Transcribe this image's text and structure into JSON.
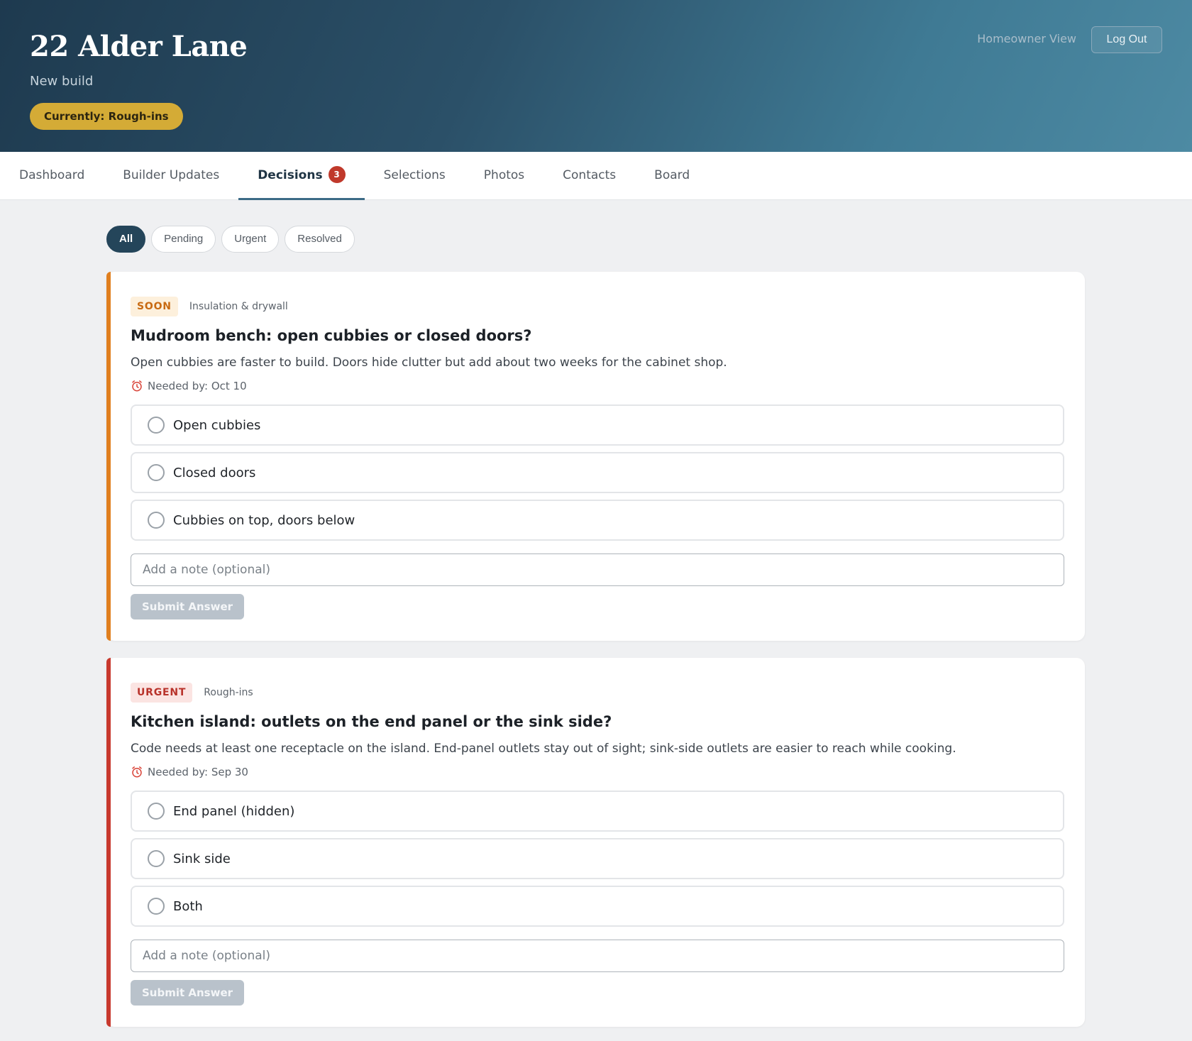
{
  "header": {
    "title": "22 Alder Lane",
    "subtitle": "New build",
    "phase_pill": "Currently: Rough-ins",
    "view_label": "Homeowner View",
    "logout_label": "Log Out"
  },
  "tabs": [
    {
      "label": "Dashboard"
    },
    {
      "label": "Builder Updates"
    },
    {
      "label": "Decisions",
      "badge": "3",
      "active": true
    },
    {
      "label": "Selections"
    },
    {
      "label": "Photos"
    },
    {
      "label": "Contacts"
    },
    {
      "label": "Board"
    }
  ],
  "filters": [
    {
      "label": "All",
      "active": true
    },
    {
      "label": "Pending"
    },
    {
      "label": "Urgent"
    },
    {
      "label": "Resolved"
    }
  ],
  "decisions": [
    {
      "tag": "SOON",
      "phase": "Insulation & drywall",
      "title": "Mudroom bench: open cubbies or closed doors?",
      "description": "Open cubbies are faster to build. Doors hide clutter but add about two weeks for the cabinet shop.",
      "needed_by": "Needed by: Oct 10",
      "options": [
        "Open cubbies",
        "Closed doors",
        "Cubbies on top, doors below"
      ],
      "note_placeholder": "Add a note (optional)",
      "submit_label": "Submit Answer"
    },
    {
      "tag": "URGENT",
      "phase": "Rough-ins",
      "title": "Kitchen island: outlets on the end panel or the sink side?",
      "description": "Code needs at least one receptacle on the island. End-panel outlets stay out of sight; sink-side outlets are easier to reach while cooking.",
      "needed_by": "Needed by: Sep 30",
      "options": [
        "End panel (hidden)",
        "Sink side",
        "Both"
      ],
      "note_placeholder": "Add a note (optional)",
      "submit_label": "Submit Answer"
    }
  ],
  "icons": {
    "clock": "alarm-clock-icon",
    "radio": "radio-unchecked-icon"
  },
  "colors": {
    "accent": "#24455a",
    "phase_pill": "#d4ab36",
    "soon": "#e07f1f",
    "urgent": "#c8392e",
    "badge": "#c0392b"
  }
}
